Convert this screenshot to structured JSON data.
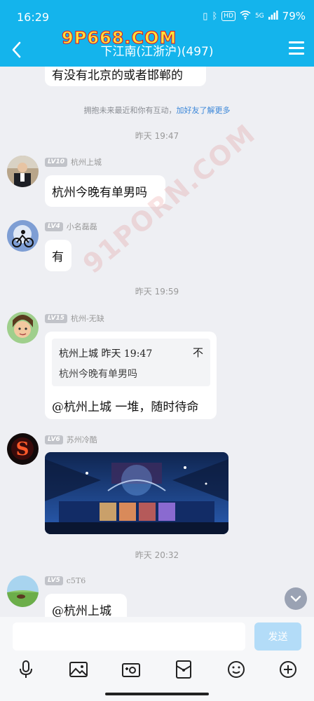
{
  "status_bar": {
    "time": "16:29",
    "battery": "79%",
    "hd": "HD",
    "net": "5G"
  },
  "header": {
    "title": "下江南(江浙沪)(497)"
  },
  "watermarks": {
    "top": "9P668.COM",
    "diagonal": "91PORN.COM"
  },
  "messages": {
    "partial_text": "有没有北京的或者邯郸的",
    "system_notice": "拥抱未来最近和你有互动，",
    "system_link": "加好友了解更多",
    "timestamp_1": "昨天 19:47",
    "msg1": {
      "level": "LV10",
      "name": "杭州上城",
      "text": "杭州今晚有单男吗"
    },
    "msg2": {
      "level": "LV4",
      "name": "小名磊磊",
      "text": "有"
    },
    "timestamp_2": "昨天 19:59",
    "msg3": {
      "level": "LV15",
      "name": "杭州-无缺",
      "quote_head": "杭州上城 昨天 19:47",
      "quote_body": "杭州今晚有单男吗",
      "quote_close": "不",
      "text": "@杭州上城 一堆，随时待命"
    },
    "msg4": {
      "level": "LV6",
      "name": "苏州冷酷"
    },
    "timestamp_3": "昨天 20:32",
    "msg5": {
      "level": "LV5",
      "name": "c5T6",
      "text": "@杭州上城"
    }
  },
  "input": {
    "placeholder": "",
    "send_label": "发送"
  },
  "toolbar_icons": [
    "microphone-icon",
    "image-icon",
    "camera-icon",
    "red-packet-icon",
    "emoji-icon",
    "plus-icon"
  ],
  "colors": {
    "header": "#14b4ec",
    "background": "#eeeff3",
    "send_button": "#b3dcf8",
    "link": "#3a86d8"
  }
}
